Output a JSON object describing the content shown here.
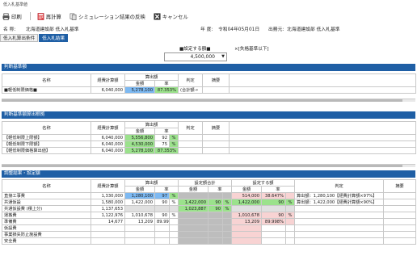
{
  "window": {
    "title": "低入札基準値"
  },
  "toolbar": {
    "print": "印刷",
    "recalc": "再計算",
    "apply": "シミュレーション結果の反映",
    "cancel": "キャンセル"
  },
  "meta": {
    "name_label": "名 称:",
    "name_value": "北海道建設部 低入札基準",
    "year_label": "年 度:",
    "year_value": "令和04年05月01日",
    "office_label": "出務元:",
    "office_value": "北海道建設部 低入札基準"
  },
  "tabs": [
    {
      "label": "低入札算出条件"
    },
    {
      "label": "低入札結果",
      "active": true
    }
  ],
  "setting": {
    "label": "■設定する額■",
    "value": "4,500,000",
    "note": "×[失格基準以下]"
  },
  "sec1": {
    "title": "判断基準額",
    "headers": {
      "name": "名称",
      "cost": "経費計算額",
      "calc": "算出額",
      "amount": "金額",
      "rate": "率",
      "judge": "判定",
      "summary": "摘要"
    },
    "rows": [
      {
        "name": "■軽低制限価格■",
        "cost": "6,040,000",
        "amount": "5,278,100",
        "rate": "87.353%",
        "judge": "(合計額→"
      }
    ]
  },
  "sec2": {
    "title": "判断基準額算出根拠",
    "headers": {
      "name": "名称",
      "cost": "経費計算額",
      "calc": "算出額",
      "amount": "金額",
      "rate": "率",
      "judge": "判定",
      "summary": "摘要"
    },
    "rows": [
      {
        "name": "【軽低制限上限額】",
        "cost": "6,040,000",
        "amount": "5,556,800",
        "rate": "92",
        "unit": "%"
      },
      {
        "name": "【軽低制限下限額】",
        "cost": "6,040,000",
        "amount": "4,530,000",
        "rate": "75",
        "unit": "%"
      },
      {
        "name": "【軽低制限価格算出値】",
        "cost": "6,040,000",
        "amount": "5,278,100",
        "rate": "87.353%",
        "unit": ""
      }
    ]
  },
  "sec3": {
    "title": "調整結果・設定額",
    "headers": {
      "name": "名称",
      "cost": "経費計算額",
      "calc": "算出額",
      "setsum": "設定額合計",
      "set": "設定する額",
      "amount": "金額",
      "rate": "率",
      "judge": "判定",
      "summary": "摘要"
    },
    "rows": [
      {
        "name": "直接工事費",
        "cost": "1,330,000",
        "c_amount": "1,280,100",
        "c_rate": "97",
        "c_unit": "%",
        "s_amount": "",
        "s_rate": "",
        "v_amount": "514,000",
        "v_rate": "38.647%",
        "note": "算出額：1,280,100【経費計算額×97%】"
      },
      {
        "name": "共通仮設",
        "cost": "1,580,000",
        "c_amount": "1,422,000",
        "c_rate": "90",
        "c_unit": "%",
        "s_amount": "1,422,000",
        "s_rate": "90",
        "v_amount": "1,422,000",
        "v_rate": "90",
        "note": "算出額：1,422,000【経費計算額×90%】"
      },
      {
        "name": "共通仮設費 (積上分)",
        "cost": "1,137,653",
        "c_amount": "",
        "c_rate": "",
        "c_unit": "",
        "s_amount": "1,023,887",
        "s_rate": "90",
        "v_amount": "",
        "v_rate": "",
        "note": ""
      },
      {
        "name": "運搬費",
        "cost": "1,122,976",
        "c_amount": "1,010,678",
        "c_rate": "90",
        "c_unit": "%",
        "s_amount": "",
        "s_rate": "",
        "v_amount": "1,010,678",
        "v_rate": "90",
        "note": ""
      },
      {
        "name": "準備費",
        "cost": "14,677",
        "c_amount": "13,209",
        "c_rate": "89.998%",
        "c_unit": "",
        "s_amount": "",
        "s_rate": "",
        "v_amount": "13,209",
        "v_rate": "89.998%",
        "note": ""
      },
      {
        "name": "仮設費",
        "cost": "",
        "c_amount": "",
        "c_rate": "",
        "c_unit": "",
        "s_amount": "",
        "s_rate": "",
        "v_amount": "",
        "v_rate": "",
        "note": ""
      },
      {
        "name": "事業損失防止施設費",
        "cost": "",
        "c_amount": "",
        "c_rate": "",
        "c_unit": "",
        "s_amount": "",
        "s_rate": "",
        "v_amount": "",
        "v_rate": "",
        "note": ""
      },
      {
        "name": "安全費",
        "cost": "",
        "c_amount": "",
        "c_rate": "",
        "c_unit": "",
        "s_amount": "",
        "s_rate": "",
        "v_amount": "",
        "v_rate": "",
        "note": ""
      }
    ]
  },
  "colors": {
    "header": "#1f5fa5",
    "blue": "#7db9f2",
    "green": "#9be28c",
    "pink": "#f8d3d3",
    "gray": "#bdbdbd"
  }
}
